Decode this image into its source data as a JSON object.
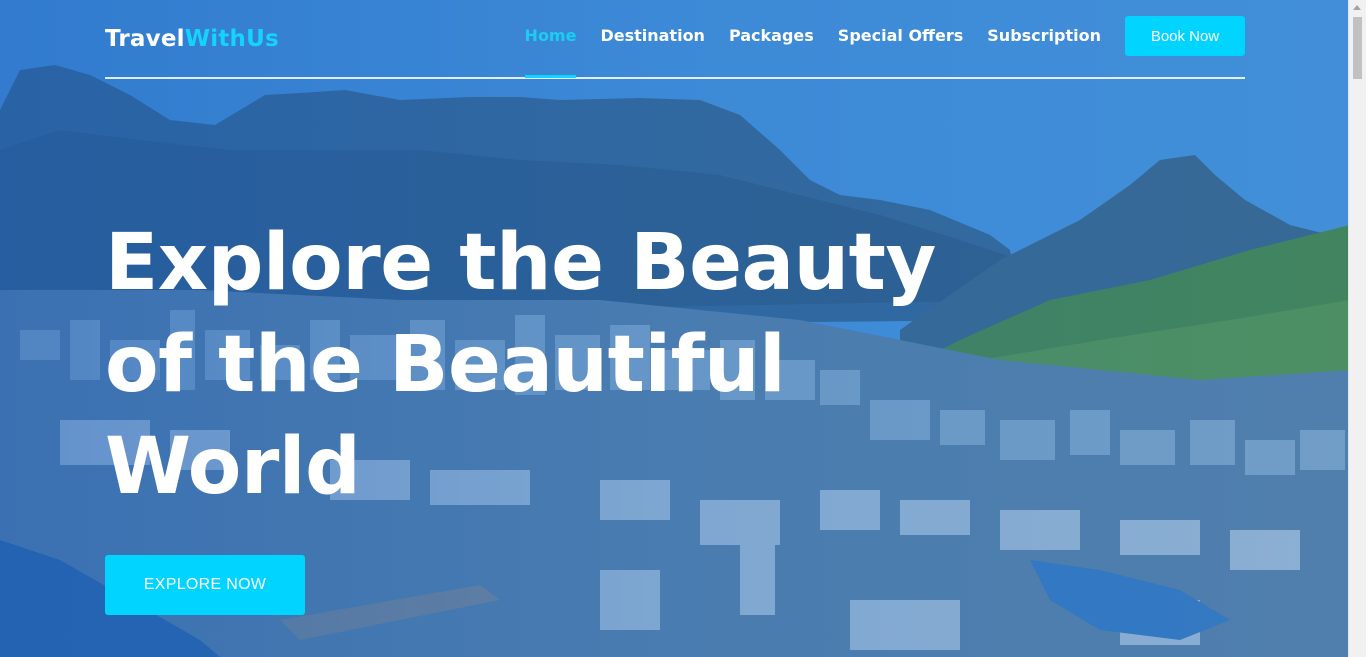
{
  "brand": {
    "part1": "Travel",
    "part2": "WithUs"
  },
  "nav": {
    "items": [
      {
        "label": "Home",
        "active": true
      },
      {
        "label": "Destination"
      },
      {
        "label": "Packages"
      },
      {
        "label": "Special Offers"
      },
      {
        "label": "Subscription"
      }
    ],
    "cta_label": "Book Now"
  },
  "hero": {
    "headline_line1": "Explore the Beauty",
    "headline_line2": "of the Beautiful",
    "headline_line3": "World",
    "button_label": "EXPLORE NOW"
  },
  "colors": {
    "accent": "#00d4ff",
    "overlay": "#1e6ed0"
  }
}
